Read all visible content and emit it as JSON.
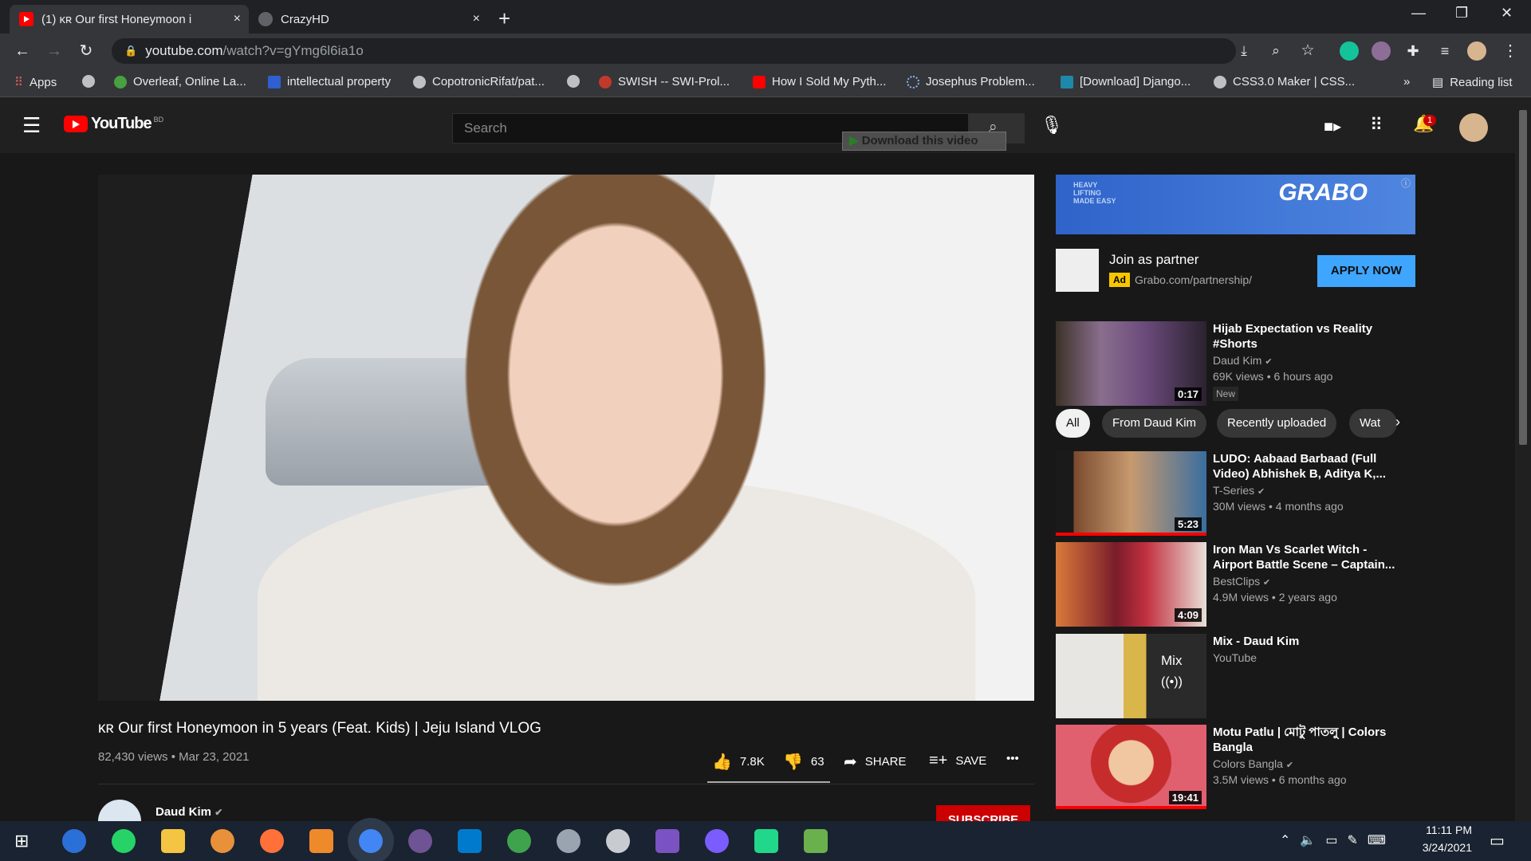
{
  "browser": {
    "tabs": [
      {
        "label": "(1) ĸʀ Our first Honeymoon i",
        "close": "×"
      },
      {
        "label": "CrazyHD",
        "close": "×"
      }
    ],
    "new_tab": "+",
    "window_controls": {
      "minimize": "—",
      "restore": "❐",
      "close": "✕"
    },
    "url_host": "youtube.com",
    "url_path": "/watch?v=gYmg6l6ia1o",
    "bookmarks": [
      "Apps",
      "Overleaf, Online La...",
      "intellectual property",
      "CopotronicRifat/pat...",
      "SWISH -- SWI-Prol...",
      "How I Sold My Pyth...",
      "Josephus Problem...",
      "[Download] Django...",
      "CSS3.0 Maker | CSS..."
    ],
    "bookmarks_overflow": "»",
    "reading_list": "Reading list"
  },
  "youtube": {
    "logo": "YouTube",
    "country_code": "BD",
    "search_placeholder": "Search",
    "download_overlay": "Download this video",
    "notification_count": "1"
  },
  "video": {
    "title": "ĸʀ Our first Honeymoon in 5 years (Feat. Kids) | Jeju Island VLOG",
    "meta": "82,430 views • Mar 23, 2021",
    "likes": "7.8K",
    "dislikes": "63",
    "share": "SHARE",
    "save": "SAVE",
    "more": "•••",
    "channel": "Daud Kim",
    "subscribe": "SUBSCRIBE"
  },
  "ad": {
    "banner_brand": "GRABO",
    "banner_tagline": "HEAVY LIFTING MADE EASY",
    "title": "Join as partner",
    "badge": "Ad",
    "url": "Grabo.com/partnership/",
    "cta": "APPLY NOW"
  },
  "chips": [
    "All",
    "From Daud Kim",
    "Recently uploaded",
    "Wat"
  ],
  "recommendations": [
    {
      "title": "Hijab Expectation vs Reality #Shorts",
      "channel": "Daud Kim",
      "views": "69K views • 6 hours ago",
      "duration": "0:17",
      "badge": "New"
    },
    {
      "title": "LUDO: Aabaad Barbaad (Full Video) Abhishek B, Aditya K,...",
      "channel": "T-Series",
      "views": "30M views • 4 months ago",
      "duration": "5:23"
    },
    {
      "title": "Iron Man Vs Scarlet Witch - Airport Battle Scene – Captain...",
      "channel": "BestClips",
      "views": "4.9M views • 2 years ago",
      "duration": "4:09"
    },
    {
      "title": "Mix - Daud Kim",
      "channel": "YouTube",
      "mix_label": "Mix"
    },
    {
      "title": "Motu Patlu | মোটু পাতলু | Colors Bangla",
      "channel": "Colors Bangla",
      "views": "3.5M views • 6 months ago",
      "duration": "19:41"
    }
  ],
  "taskbar": {
    "time": "11:11 PM",
    "date": "3/24/2021"
  },
  "colors": {
    "yt_red": "#ff0000",
    "subscribe": "#cc0000",
    "apply": "#3ea6ff",
    "bg": "#181818"
  }
}
